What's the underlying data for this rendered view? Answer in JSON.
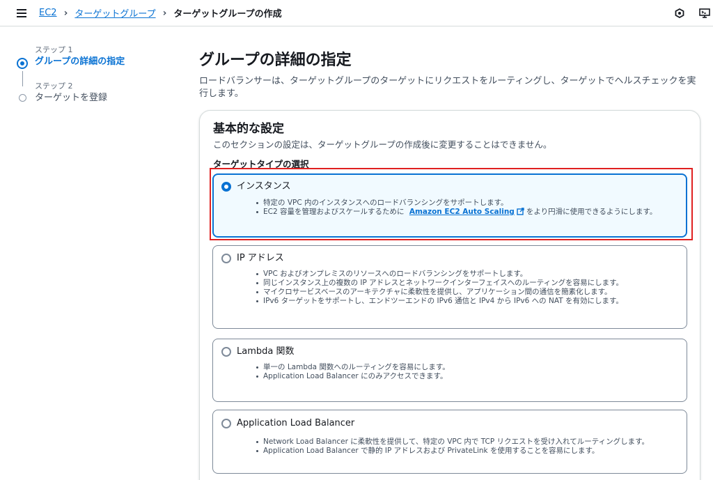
{
  "breadcrumb": {
    "items": [
      "EC2",
      "ターゲットグループ"
    ],
    "current": "ターゲットグループの作成"
  },
  "top_icons": [
    "settings-hex-icon",
    "cloudshell-icon"
  ],
  "steps": [
    {
      "num": "ステップ 1",
      "title": "グループの詳細の指定",
      "active": true
    },
    {
      "num": "ステップ 2",
      "title": "ターゲットを登録",
      "active": false
    }
  ],
  "page": {
    "title": "グループの詳細の指定",
    "description": "ロードバランサーは、ターゲットグループのターゲットにリクエストをルーティングし、ターゲットでヘルスチェックを実行します。"
  },
  "basic": {
    "title": "基本的な設定",
    "description": "このセクションの設定は、ターゲットグループの作成後に変更することはできません。",
    "target_type_label": "ターゲットタイプの選択"
  },
  "target_types": [
    {
      "label": "インスタンス",
      "selected": true,
      "bullets": [
        "特定の VPC 内のインスタンスへのロードバランシングをサポートします。"
      ],
      "link_bullet": {
        "before": "EC2 容量を管理およびスケールするために",
        "link": "Amazon EC2 Auto Scaling",
        "after": "をより円滑に使用できるようにします。"
      }
    },
    {
      "label": "IP アドレス",
      "selected": false,
      "bullets": [
        "VPC およびオンプレミスのリソースへのロードバランシングをサポートします。",
        "同じインスタンス上の複数の IP アドレスとネットワークインターフェイスへのルーティングを容易にします。",
        "マイクロサービスベースのアーキテクチャに柔軟性を提供し、アプリケーション間の通信を簡素化します。",
        "IPv6 ターゲットをサポートし、エンドツーエンドの IPv6 通信と IPv4 から IPv6 への NAT を有効にします。"
      ]
    },
    {
      "label": "Lambda 関数",
      "selected": false,
      "bullets": [
        "単一の Lambda 関数へのルーティングを容易にします。",
        "Application Load Balancer にのみアクセスできます。"
      ]
    },
    {
      "label": "Application Load Balancer",
      "selected": false,
      "bullets": [
        "Network Load Balancer に柔軟性を提供して、特定の VPC 内で TCP リクエストを受け入れてルーティングします。",
        "Application Load Balancer で静的 IP アドレスおよび PrivateLink を使用することを容易にします。"
      ]
    }
  ],
  "colors": {
    "link": "#0972d3",
    "selected_bg": "#f1faff",
    "highlight": "#e02020"
  }
}
